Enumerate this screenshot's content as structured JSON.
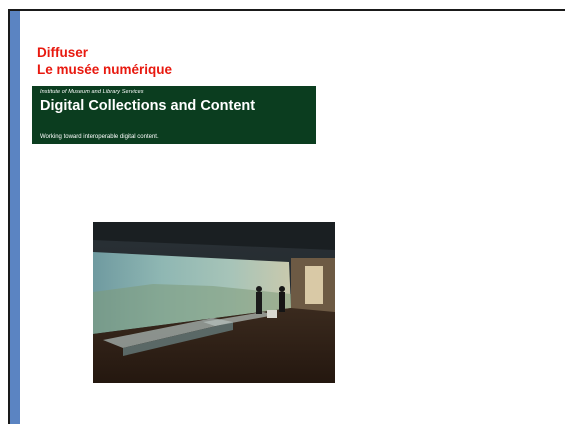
{
  "slide": {
    "title_line1": "Diffuser",
    "title_line2": "Le musée numérique",
    "title_color": "#e8190f",
    "accent_color": "#5b84c2"
  },
  "banner": {
    "eyebrow": "Institute of Museum and Library Services",
    "heading": "Digital Collections and Content",
    "tagline": "Working toward interoperable digital content.",
    "background": "#0b3d1f"
  },
  "photo": {
    "subject": "museum-gallery-photo"
  }
}
